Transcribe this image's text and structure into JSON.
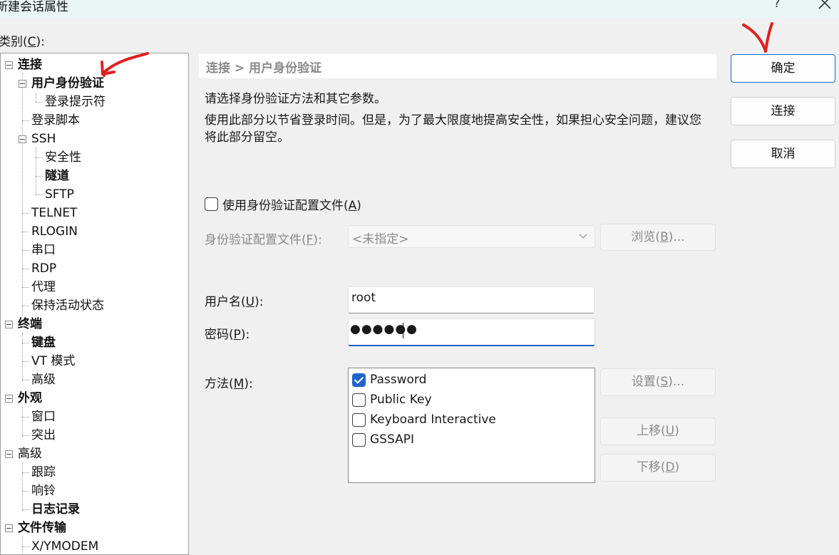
{
  "window": {
    "title": "新建会话属性",
    "help_glyph": "?"
  },
  "category": {
    "label": "类别",
    "accel": "C",
    "suffix": "):"
  },
  "tree": {
    "items": [
      {
        "label": "连接",
        "bold": true
      },
      {
        "label": "用户身份验证",
        "bold": true,
        "selected": true
      },
      {
        "label": "登录提示符",
        "bold": false
      },
      {
        "label": "登录脚本",
        "bold": false
      },
      {
        "label": "SSH",
        "bold": false
      },
      {
        "label": "安全性",
        "bold": false
      },
      {
        "label": "隧道",
        "bold": true
      },
      {
        "label": "SFTP",
        "bold": false
      },
      {
        "label": "TELNET",
        "bold": false
      },
      {
        "label": "RLOGIN",
        "bold": false
      },
      {
        "label": "串口",
        "bold": false
      },
      {
        "label": "RDP",
        "bold": false
      },
      {
        "label": "代理",
        "bold": false
      },
      {
        "label": "保持活动状态",
        "bold": false
      },
      {
        "label": "终端",
        "bold": true
      },
      {
        "label": "键盘",
        "bold": true
      },
      {
        "label": "VT 模式",
        "bold": false
      },
      {
        "label": "高级",
        "bold": false
      },
      {
        "label": "外观",
        "bold": true
      },
      {
        "label": "窗口",
        "bold": false
      },
      {
        "label": "突出",
        "bold": false
      },
      {
        "label": "高级",
        "bold": false
      },
      {
        "label": "跟踪",
        "bold": false
      },
      {
        "label": "响铃",
        "bold": false
      },
      {
        "label": "日志记录",
        "bold": true
      },
      {
        "label": "文件传输",
        "bold": true
      },
      {
        "label": "X/YMODEM",
        "bold": false
      }
    ]
  },
  "breadcrumb": "连接 > 用户身份验证",
  "description": {
    "line1": "请选择身份验证方法和其它参数。",
    "line2": "使用此部分以节省登录时间。但是，为了最大限度地提高安全性，如果担心安全问题，建议您将此部分留空。"
  },
  "use_profile": {
    "label": "使用身份验证配置文件",
    "accel": "A",
    "checked": false
  },
  "profile": {
    "label": "身份验证配置文件",
    "accel": "F",
    "value": "<未指定>"
  },
  "browse": {
    "label": "浏览",
    "accel": "B",
    "suffix": ")..."
  },
  "username": {
    "label": "用户名",
    "accel": "U",
    "value": "root"
  },
  "password": {
    "label": "密码",
    "accel": "P",
    "value": "●●●●●●"
  },
  "method": {
    "label": "方法",
    "accel": "M",
    "items": [
      {
        "label": "Password",
        "checked": true
      },
      {
        "label": "Public Key",
        "checked": false
      },
      {
        "label": "Keyboard Interactive",
        "checked": false
      },
      {
        "label": "GSSAPI",
        "checked": false
      }
    ]
  },
  "settings": {
    "label": "设置",
    "accel": "S",
    "suffix": ")..."
  },
  "move_up": {
    "label": "上移",
    "accel": "U",
    "suffix": ")"
  },
  "move_down": {
    "label": "下移",
    "accel": "D",
    "suffix": ")"
  },
  "buttons": {
    "ok": "确定",
    "connect": "连接",
    "cancel": "取消"
  },
  "colors": {
    "accent": "#1f63c6",
    "annotation": "#e02020",
    "titlebar": "#eaf6f6"
  }
}
